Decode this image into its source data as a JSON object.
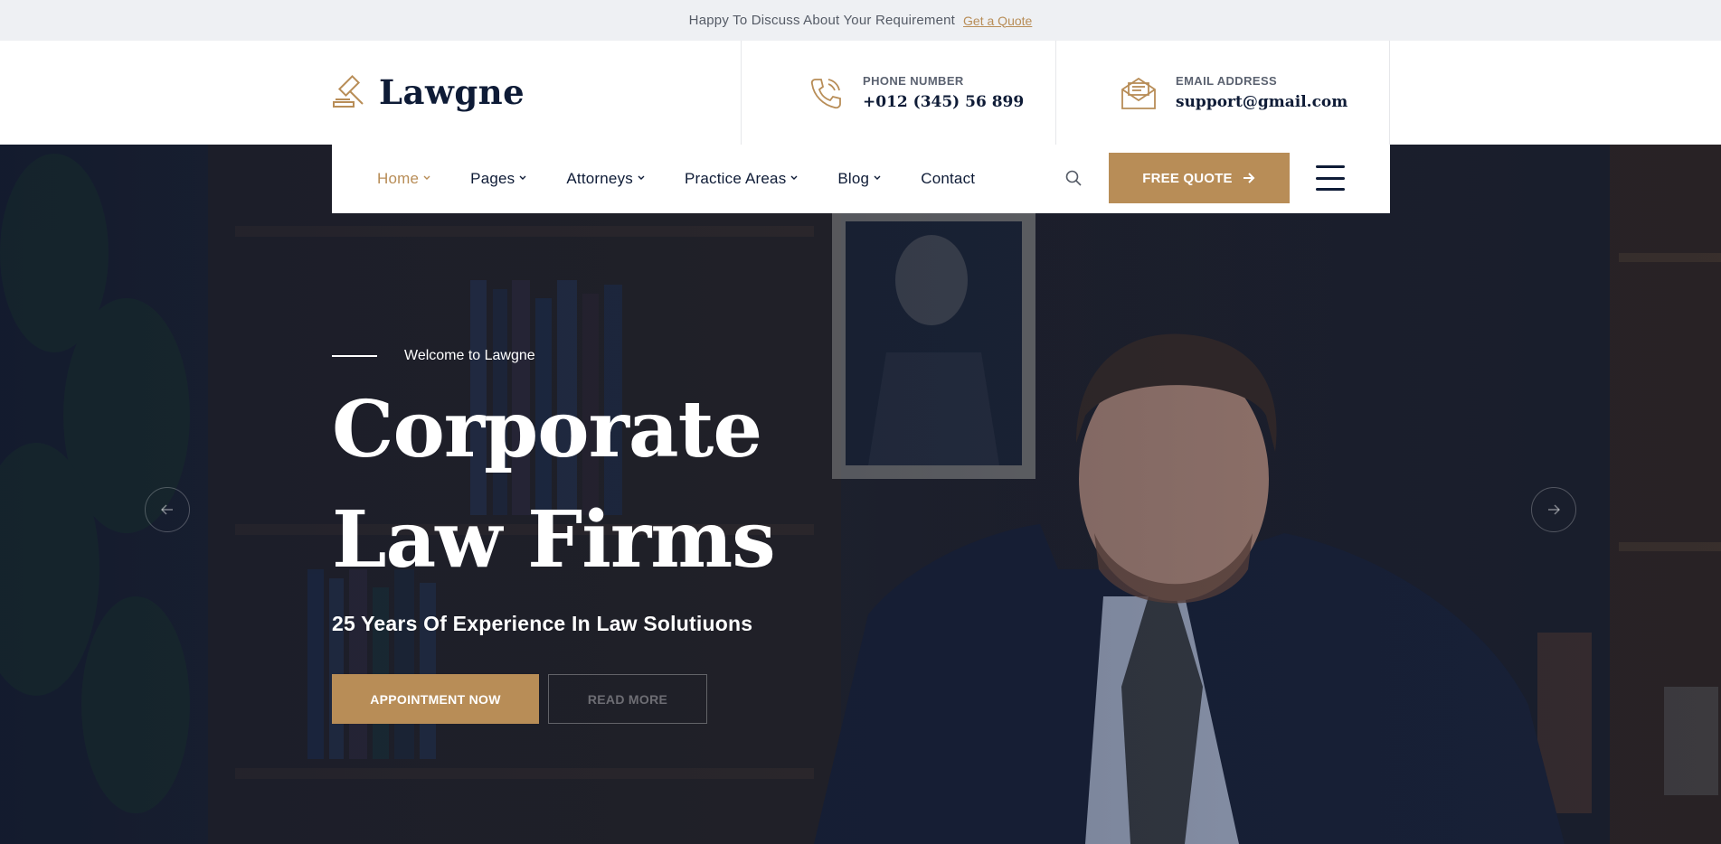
{
  "topbar": {
    "message": "Happy To Discuss About Your Requirement",
    "link_label": "Get a Quote"
  },
  "brand": {
    "name": "Lawgne",
    "icon": "gavel-icon"
  },
  "contacts": {
    "phone": {
      "label": "PHONE NUMBER",
      "value": "+012 (345) 56 899",
      "icon": "phone-icon"
    },
    "email": {
      "label": "EMAIL ADDRESS",
      "value": "support@gmail.com",
      "icon": "envelope-icon"
    }
  },
  "nav": {
    "items": [
      {
        "label": "Home",
        "has_dropdown": true,
        "active": true
      },
      {
        "label": "Pages",
        "has_dropdown": true,
        "active": false
      },
      {
        "label": "Attorneys",
        "has_dropdown": true,
        "active": false
      },
      {
        "label": "Practice Areas",
        "has_dropdown": true,
        "active": false
      },
      {
        "label": "Blog",
        "has_dropdown": true,
        "active": false
      },
      {
        "label": "Contact",
        "has_dropdown": false,
        "active": false
      }
    ],
    "cta_label": "FREE QUOTE"
  },
  "hero": {
    "welcome": "Welcome to Lawgne",
    "title_line1": "Corporate",
    "title_line2": "Law Firms",
    "subtitle": "25 Years Of Experience In Law Solutiuons",
    "primary_button": "APPOINTMENT NOW",
    "secondary_button": "READ MORE"
  },
  "colors": {
    "accent": "#b88d57",
    "dark": "#0e1b36",
    "topbar_bg": "#eef0f3"
  }
}
